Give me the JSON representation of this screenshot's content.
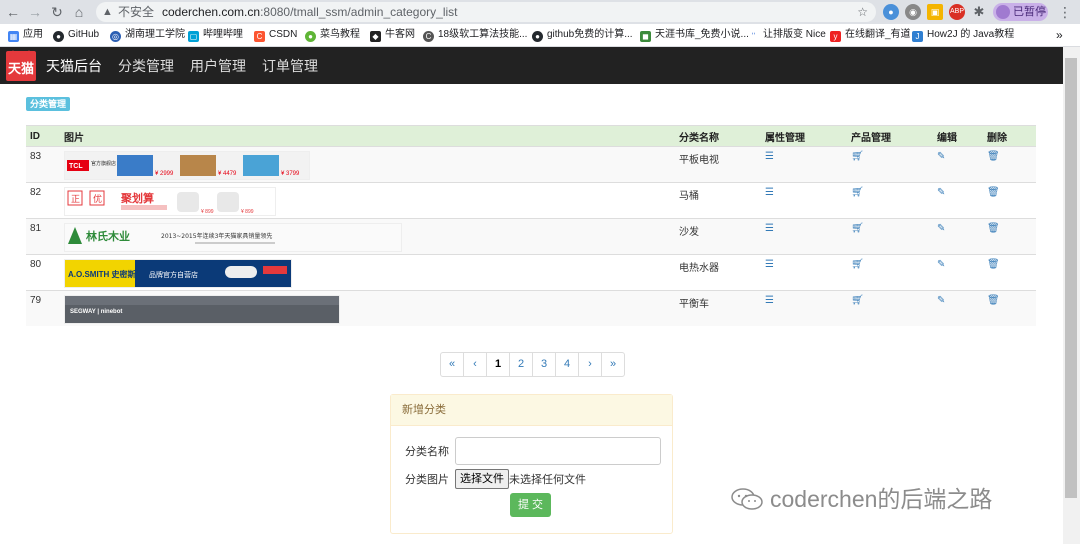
{
  "browser": {
    "insecure_label": "不安全",
    "url_host": "coderchen.com.cn",
    "url_path": ":8080/tmall_ssm/admin_category_list",
    "paused_label": "已暂停",
    "bookmarks": [
      "应用",
      "GitHub",
      "湖南理工学院",
      "哔哩哔哩",
      "CSDN",
      "菜鸟教程",
      "牛客网",
      "18级软工算法技能...",
      "github免费的计算...",
      "天涯书库_免费小说...",
      "让排版变 Nice",
      "在线翻译_有道",
      "How2J 的 Java教程"
    ],
    "more_bookmarks": "»"
  },
  "navbar": {
    "logo_text": "天猫",
    "brand": "天猫后台",
    "links": [
      "分类管理",
      "用户管理",
      "订单管理"
    ]
  },
  "page": {
    "badge": "分类管理"
  },
  "table": {
    "headers": [
      "ID",
      "图片",
      "分类名称",
      "属性管理",
      "产品管理",
      "编辑",
      "删除"
    ],
    "rows": [
      {
        "id": "83",
        "name": "平板电视",
        "banner": {
          "brand": "TCL",
          "sub": "官方旗舰店",
          "prices": [
            "¥ 2999",
            "¥ 4479",
            "¥ 3799"
          ]
        }
      },
      {
        "id": "82",
        "name": "马桶",
        "banner": {
          "brand": "聚划算",
          "tags": [
            "正",
            "优"
          ],
          "prices": [
            "¥ 899",
            "¥ 899"
          ]
        }
      },
      {
        "id": "81",
        "name": "沙发",
        "banner": {
          "brand": "林氏木业",
          "slogan": "2013~2015年连续3年天猫家具销量领先"
        }
      },
      {
        "id": "80",
        "name": "电热水器",
        "banner": {
          "brand": "A.O.SMITH 史密斯",
          "slogan": "品牌官方自营店"
        }
      },
      {
        "id": "79",
        "name": "平衡车",
        "banner": {
          "brand": "SEGWAY | ninebot"
        }
      }
    ]
  },
  "pagination": [
    "«",
    "‹",
    "1",
    "2",
    "3",
    "4",
    "›",
    "»"
  ],
  "pagination_active": "1",
  "add_panel": {
    "title": "新增分类",
    "name_label": "分类名称",
    "name_value": "",
    "image_label": "分类图片",
    "file_button": "选择文件",
    "file_status": "未选择任何文件",
    "submit": "提 交"
  },
  "watermark": "coderchen的后端之路",
  "colors": {
    "navbar_bg": "#222222",
    "header_row": "#dff0d8",
    "link_blue": "#337ab7",
    "submit_green": "#5cb85c",
    "badge_cyan": "#5bc0de",
    "logo_red": "#e4393c"
  }
}
